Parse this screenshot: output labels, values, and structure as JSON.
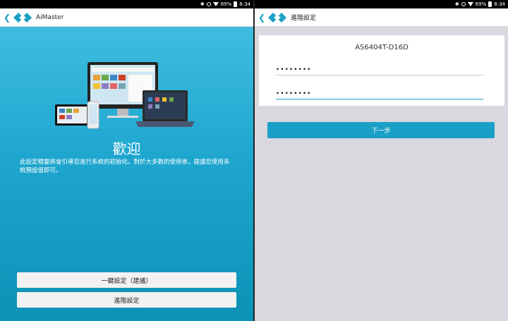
{
  "left": {
    "status": {
      "battery": "69%",
      "time": "8:34"
    },
    "app_title": "AiMaster",
    "welcome_title": "歡迎",
    "intro_text": "此設定精靈將會引導您進行系統的初始化。對於大多數的使用者，建議您使用系統預設值即可。",
    "one_click_label": "一鍵設定（建議）",
    "advanced_label": "進階設定"
  },
  "right": {
    "status": {
      "battery": "69%",
      "time": "8:34"
    },
    "page_title": "進階設定",
    "device_name": "AS6404T-D16D",
    "password1": "••••••••",
    "password2": "••••••••",
    "next_label": "下一步"
  },
  "colors": {
    "accent": "#1aa0c6",
    "gradient_top": "#3fbde0",
    "gradient_bottom": "#0c92b6"
  }
}
